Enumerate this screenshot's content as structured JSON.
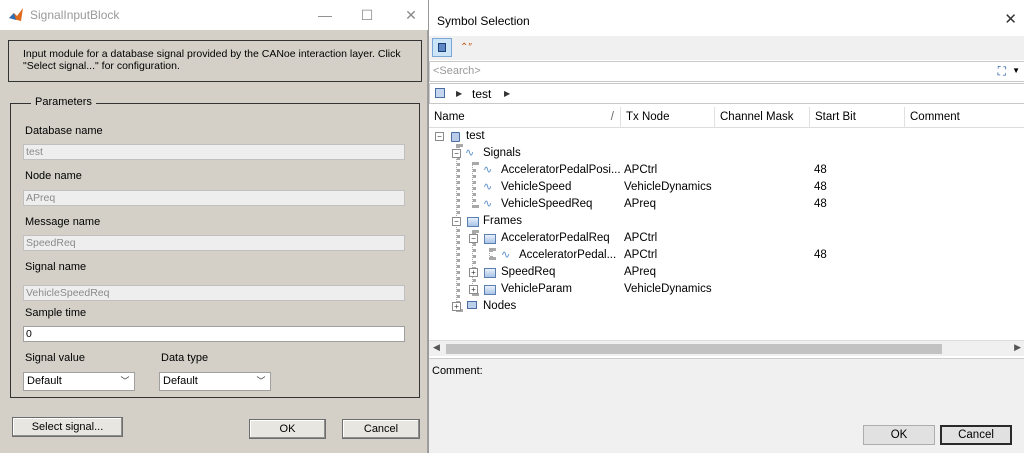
{
  "left": {
    "title": "SignalInputBlock",
    "description": "Input module for a database signal provided by the CANoe interaction layer. Click \"Select signal...\" for configuration.",
    "params_legend": "Parameters",
    "db_label": "Database name",
    "db_value": "test",
    "node_label": "Node name",
    "node_value": "APreq",
    "msg_label": "Message name",
    "msg_value": "SpeedReq",
    "sig_label": "Signal name",
    "sig_value": "VehicleSpeedReq",
    "sample_label": "Sample time",
    "sample_value": "0",
    "sigval_label": "Signal value",
    "sigval_value": "Default",
    "dtype_label": "Data type",
    "dtype_value": "Default",
    "select_btn": "Select signal...",
    "ok_btn": "OK",
    "cancel_btn": "Cancel"
  },
  "right": {
    "title": "Symbol Selection",
    "search_placeholder": "<Search>",
    "breadcrumb": "test",
    "columns": [
      "Name",
      "Tx Node",
      "Channel Mask",
      "Start Bit",
      "Comment"
    ],
    "tree": {
      "root": "test",
      "signals": "Signals",
      "sig1": {
        "name": "AcceleratorPedalPosi...",
        "tx": "APCtrl",
        "bit": "48"
      },
      "sig2": {
        "name": "VehicleSpeed",
        "tx": "VehicleDynamics",
        "bit": "48"
      },
      "sig3": {
        "name": "VehicleSpeedReq",
        "tx": "APreq",
        "bit": "48"
      },
      "frames": "Frames",
      "frm1": {
        "name": "AcceleratorPedalReq",
        "tx": "APCtrl"
      },
      "frm1sig": {
        "name": "AcceleratorPedal...",
        "tx": "APCtrl",
        "bit": "48"
      },
      "frm2": {
        "name": "SpeedReq",
        "tx": "APreq"
      },
      "frm3": {
        "name": "VehicleParam",
        "tx": "VehicleDynamics"
      },
      "nodes": "Nodes"
    },
    "comment_label": "Comment:",
    "ok_btn": "OK",
    "cancel_btn": "Cancel"
  }
}
